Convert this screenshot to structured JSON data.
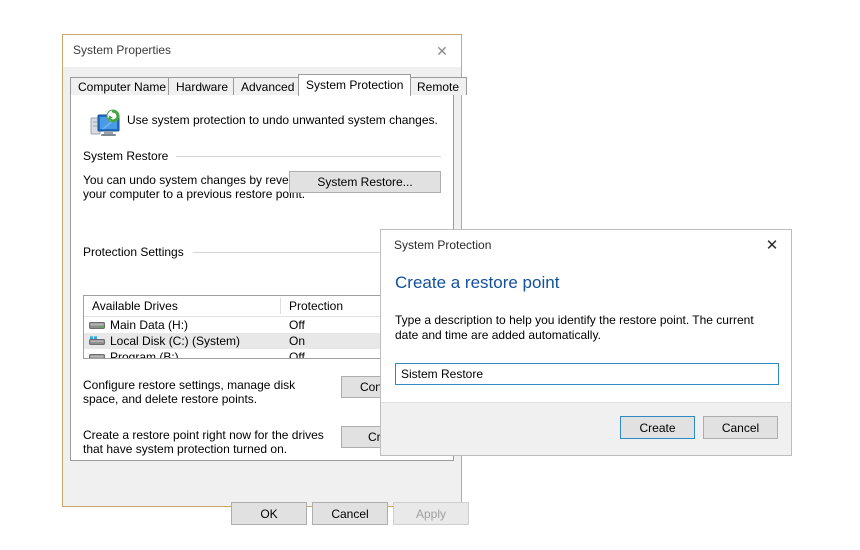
{
  "main_window": {
    "title": "System Properties",
    "close_icon": "close-icon",
    "tabs": [
      {
        "label": "Computer Name",
        "active": false
      },
      {
        "label": "Hardware",
        "active": false
      },
      {
        "label": "Advanced",
        "active": false
      },
      {
        "label": "System Protection",
        "active": true
      },
      {
        "label": "Remote",
        "active": false
      }
    ],
    "intro": {
      "icon": "system-protection-icon",
      "text": "Use system protection to undo unwanted system changes."
    },
    "system_restore_group": {
      "label": "System Restore",
      "description": "You can undo system changes by reverting your computer to a previous restore point.",
      "button_label": "System Restore..."
    },
    "protection_settings_group": {
      "label": "Protection Settings",
      "columns": [
        "Available Drives",
        "Protection"
      ],
      "drives": [
        {
          "name": "Main Data (H:)",
          "protection": "Off",
          "icon": "hard-drive-icon",
          "selected": false
        },
        {
          "name": "Local Disk (C:) (System)",
          "protection": "On",
          "icon": "system-drive-icon",
          "selected": true
        },
        {
          "name": "Program (B:)",
          "protection": "Off",
          "icon": "hard-drive-icon",
          "selected": false
        }
      ],
      "configure": {
        "description": "Configure restore settings, manage disk space, and delete restore points.",
        "button_label": "Configure..."
      },
      "create": {
        "description": "Create a restore point right now for the drives that have system protection turned on.",
        "button_label": "Create..."
      }
    },
    "footer_buttons": {
      "ok": "OK",
      "cancel": "Cancel",
      "apply": "Apply",
      "apply_disabled": true
    }
  },
  "dialog": {
    "title": "System Protection",
    "close_icon": "close-icon",
    "heading": "Create a restore point",
    "description": "Type a description to help you identify the restore point. The current date and time are added automatically.",
    "input": {
      "value": "Sistem Restore",
      "placeholder": ""
    },
    "buttons": {
      "create": "Create",
      "cancel": "Cancel"
    }
  },
  "colors": {
    "window_border": "#c8a96a",
    "dialog_heading": "#12519c",
    "input_focus_border": "#2e8ac0",
    "dialog_bg": "#ffffff",
    "footer_bg": "#f0f0f0",
    "selected_row": "#e8e8e8"
  }
}
